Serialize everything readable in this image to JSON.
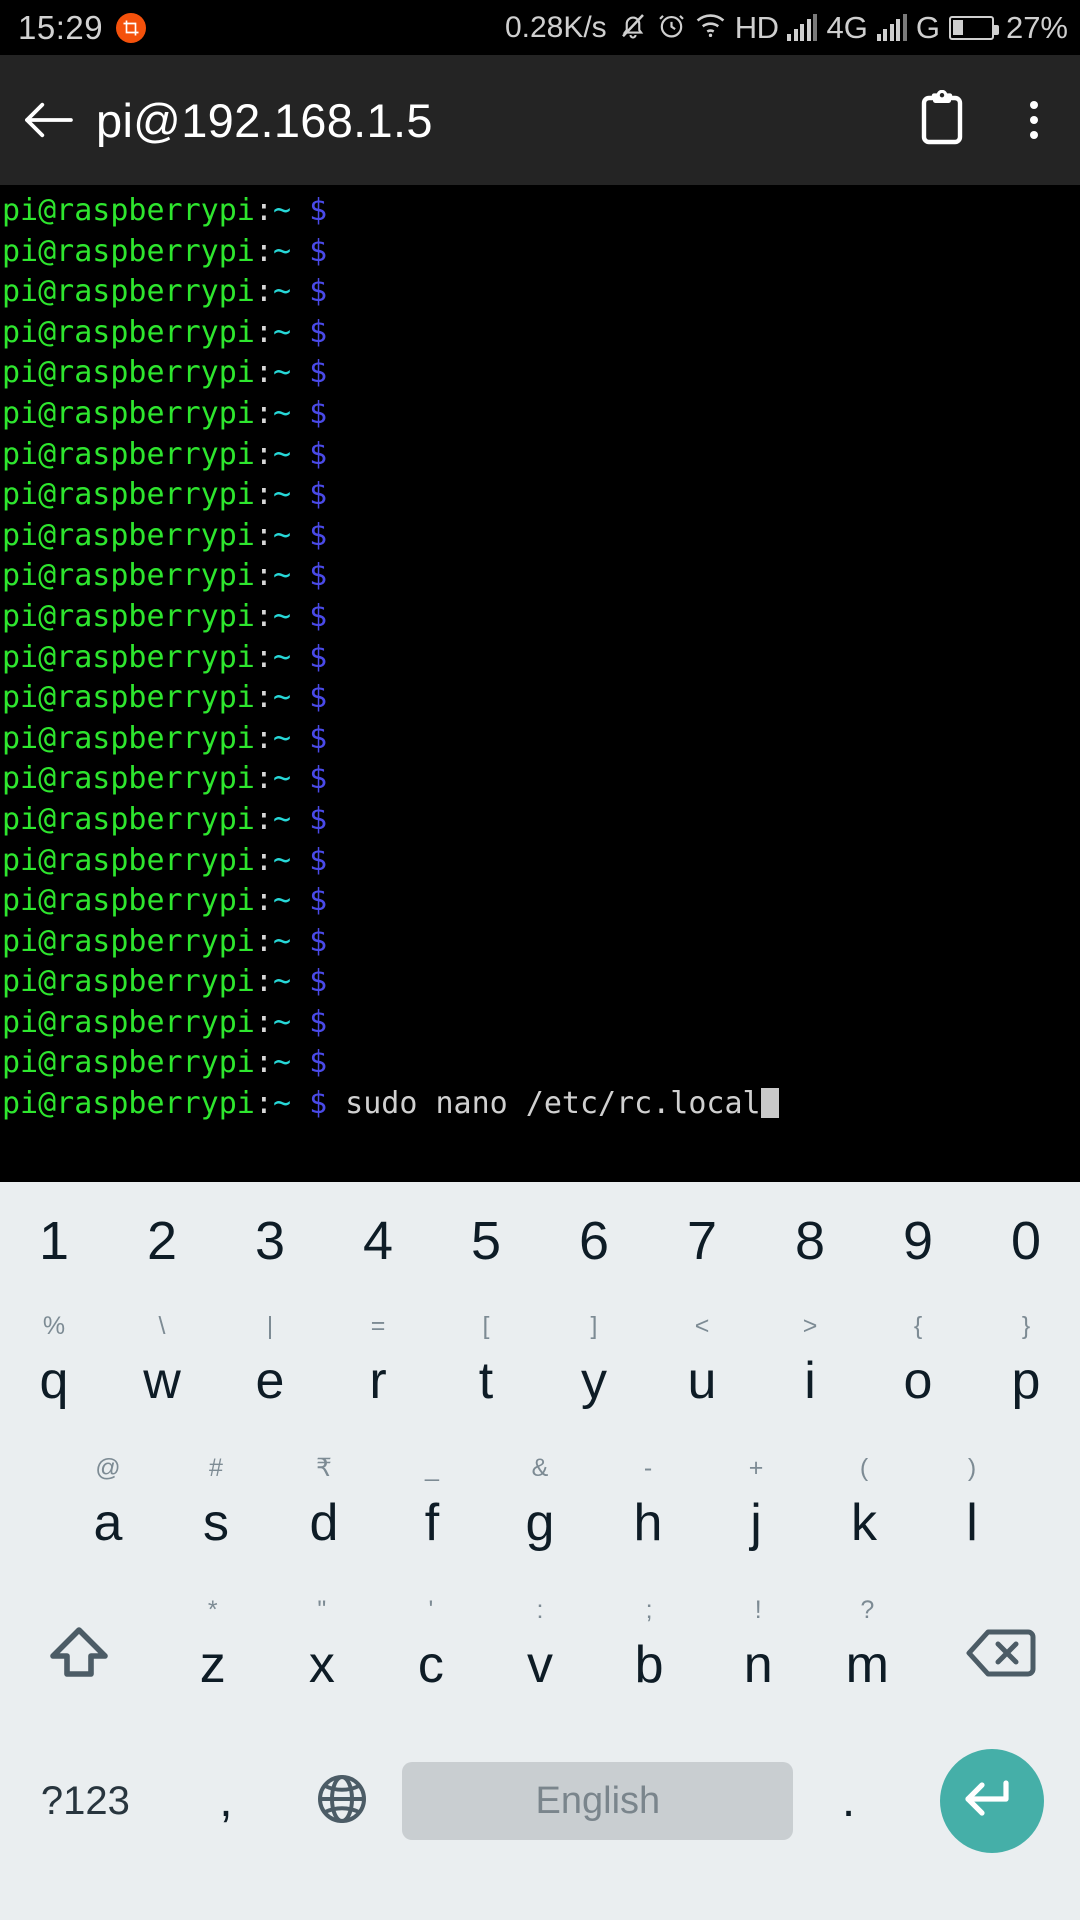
{
  "status_bar": {
    "time": "15:29",
    "screenshot_icon": "crop-icon",
    "network_speed": "0.28K/s",
    "icons": [
      "bell-muted-icon",
      "alarm-clock-icon",
      "wifi-icon"
    ],
    "hd_label": "HD",
    "network_type": "4G",
    "network_type_2": "G",
    "battery_percent": "27%",
    "battery_level": 27
  },
  "app_bar": {
    "back_icon": "arrow-left-icon",
    "title": "pi@192.168.1.5",
    "paste_icon": "clipboard-icon",
    "overflow_icon": "more-vertical-icon"
  },
  "terminal": {
    "prompt_user": "pi@raspberrypi",
    "prompt_colon": ":",
    "prompt_path": "~",
    "prompt_symbol": "$",
    "blank_prompt_count": 22,
    "command": "sudo nano /etc/rc.local",
    "colors": {
      "user": "#2EE62E",
      "path": "#27D8D8",
      "symbol": "#4A4AE8",
      "command": "#D0D0D0",
      "background": "#000000"
    }
  },
  "keyboard": {
    "language": "English",
    "symbols_key": "?123",
    "comma_key": ",",
    "period_key": ".",
    "globe_icon": "globe-icon",
    "shift_icon": "shift-up-arrow-icon",
    "backspace_icon": "backspace-icon",
    "enter_icon": "enter-return-icon",
    "enter_color": "#45AFA8",
    "background": "#EAEEF0",
    "rows": {
      "numbers": [
        {
          "main": "1"
        },
        {
          "main": "2"
        },
        {
          "main": "3"
        },
        {
          "main": "4"
        },
        {
          "main": "5"
        },
        {
          "main": "6"
        },
        {
          "main": "7"
        },
        {
          "main": "8"
        },
        {
          "main": "9"
        },
        {
          "main": "0"
        }
      ],
      "top": [
        {
          "main": "q",
          "sub": "%"
        },
        {
          "main": "w",
          "sub": "\\"
        },
        {
          "main": "e",
          "sub": "|"
        },
        {
          "main": "r",
          "sub": "="
        },
        {
          "main": "t",
          "sub": "["
        },
        {
          "main": "y",
          "sub": "]"
        },
        {
          "main": "u",
          "sub": "<"
        },
        {
          "main": "i",
          "sub": ">"
        },
        {
          "main": "o",
          "sub": "{"
        },
        {
          "main": "p",
          "sub": "}"
        }
      ],
      "home": [
        {
          "main": "a",
          "sub": "@"
        },
        {
          "main": "s",
          "sub": "#"
        },
        {
          "main": "d",
          "sub": "₹"
        },
        {
          "main": "f",
          "sub": "_"
        },
        {
          "main": "g",
          "sub": "&"
        },
        {
          "main": "h",
          "sub": "-"
        },
        {
          "main": "j",
          "sub": "+"
        },
        {
          "main": "k",
          "sub": "("
        },
        {
          "main": "l",
          "sub": ")"
        }
      ],
      "bottom": [
        {
          "main": "z",
          "sub": "*"
        },
        {
          "main": "x",
          "sub": "\""
        },
        {
          "main": "c",
          "sub": "'"
        },
        {
          "main": "v",
          "sub": ":"
        },
        {
          "main": "b",
          "sub": ";"
        },
        {
          "main": "n",
          "sub": "!"
        },
        {
          "main": "m",
          "sub": "?"
        }
      ]
    }
  }
}
